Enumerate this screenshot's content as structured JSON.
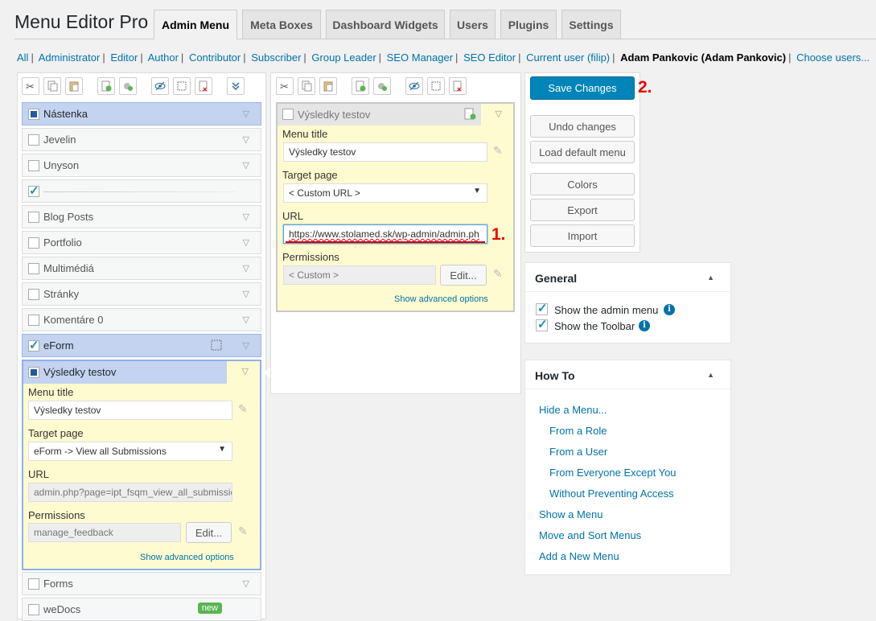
{
  "app_title": "Menu Editor Pro",
  "tabs": [
    "Admin Menu",
    "Meta Boxes",
    "Dashboard Widgets",
    "Users",
    "Plugins",
    "Settings"
  ],
  "roles": [
    "All",
    "Administrator",
    "Editor",
    "Author",
    "Contributor",
    "Subscriber",
    "Group Leader",
    "SEO Manager",
    "SEO Editor",
    "Current user (filip)"
  ],
  "current_role": "Adam Pankovic (Adam Pankovic)",
  "choose_users": "Choose users...",
  "menu_items": [
    "Nástenka",
    "Jevelin",
    "Unyson",
    "",
    "Blog Posts",
    "Portfolio",
    "Multimédiá",
    "Stránky",
    "Komentáre 0",
    "eForm"
  ],
  "expanded_item": {
    "title": "Výsledky testov",
    "menu_title_label": "Menu title",
    "menu_title_value": "Výsledky testov",
    "target_label": "Target page",
    "target_value": "eForm -> View all Submissions",
    "url_label": "URL",
    "url_value": "admin.php?page=ipt_fsqm_view_all_submissic",
    "permissions_label": "Permissions",
    "permissions_value": "manage_feedback",
    "edit_label": "Edit...",
    "advanced": "Show advanced options"
  },
  "after_items": [
    "Forms",
    "weDocs"
  ],
  "new_badge": "new",
  "submenu": {
    "title": "Výsledky testov",
    "menu_title_label": "Menu title",
    "menu_title_value": "Výsledky testov",
    "target_label": "Target page",
    "target_value": "< Custom URL >",
    "url_label": "URL",
    "url_value": "https://www.stolamed.sk/wp-admin/admin.ph",
    "permissions_label": "Permissions",
    "permissions_value": "< Custom >",
    "edit_label": "Edit...",
    "advanced": "Show advanced options"
  },
  "annotations": {
    "one": "1.",
    "two": "2."
  },
  "actions": {
    "save": "Save Changes",
    "undo": "Undo changes",
    "load_default": "Load default menu",
    "colors": "Colors",
    "export": "Export",
    "import": "Import"
  },
  "general": {
    "title": "General",
    "show_admin_menu": "Show the admin menu",
    "show_toolbar": "Show the Toolbar"
  },
  "howto": {
    "title": "How To",
    "links": [
      "Hide a Menu...",
      "From a Role",
      "From a User",
      "From Everyone Except You",
      "Without Preventing Access",
      "Show a Menu",
      "Move and Sort Menus",
      "Add a New Menu"
    ]
  }
}
